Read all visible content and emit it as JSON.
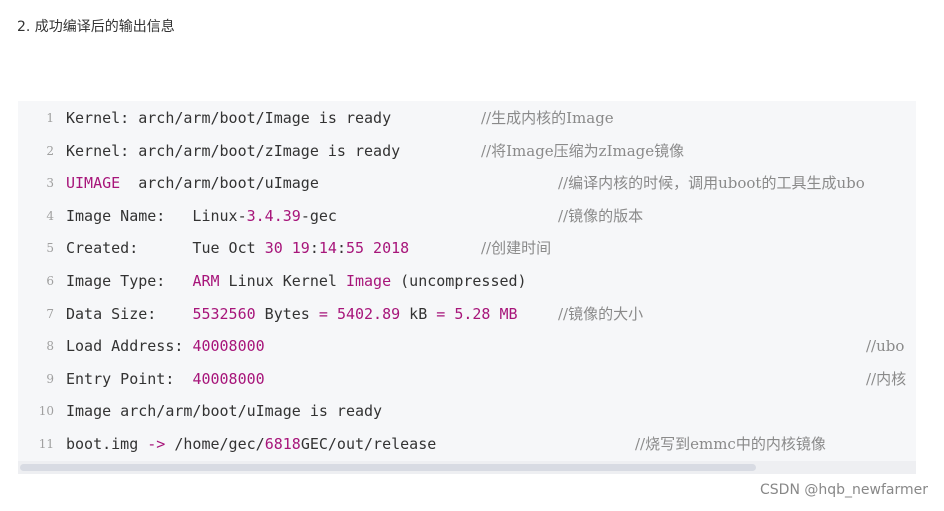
{
  "heading": "2. 成功编译后的输出信息",
  "code_lines": [
    {
      "number": "1",
      "segments": [
        {
          "t": "Kernel: arch/arm/boot/Image is ready"
        }
      ],
      "comment": "//生成内核的Image"
    },
    {
      "number": "2",
      "segments": [
        {
          "t": "Kernel: arch/arm/boot/zImage is ready"
        }
      ],
      "comment": "//将Image压缩为zImage镜像"
    },
    {
      "number": "3",
      "segments": [
        {
          "t": "UIMAGE",
          "c": "kw"
        },
        {
          "t": "  arch/arm/boot/uImage"
        }
      ],
      "comment": "//编译内核的时候，调用uboot的工具生成ubo"
    },
    {
      "number": "4",
      "segments": [
        {
          "t": "Image Name:   Linux-"
        },
        {
          "t": "3.4.39",
          "c": "num"
        },
        {
          "t": "-gec"
        }
      ],
      "comment": "//镜像的版本"
    },
    {
      "number": "5",
      "segments": [
        {
          "t": "Created:      Tue Oct "
        },
        {
          "t": "30 19",
          "c": "num"
        },
        {
          "t": ":"
        },
        {
          "t": "14",
          "c": "num"
        },
        {
          "t": ":"
        },
        {
          "t": "55 2018",
          "c": "num"
        }
      ],
      "comment": "//创建时间"
    },
    {
      "number": "6",
      "segments": [
        {
          "t": "Image Type:   "
        },
        {
          "t": "ARM",
          "c": "kw"
        },
        {
          "t": " Linux Kernel "
        },
        {
          "t": "Image",
          "c": "kw"
        },
        {
          "t": " (uncompressed)"
        }
      ],
      "comment": ""
    },
    {
      "number": "7",
      "segments": [
        {
          "t": "Data Size:    "
        },
        {
          "t": "5532560",
          "c": "num"
        },
        {
          "t": " Bytes "
        },
        {
          "t": "=",
          "c": "op"
        },
        {
          "t": " "
        },
        {
          "t": "5402.89",
          "c": "num"
        },
        {
          "t": " kB "
        },
        {
          "t": "=",
          "c": "op"
        },
        {
          "t": " "
        },
        {
          "t": "5.28 MB",
          "c": "num"
        }
      ],
      "comment": "//镜像的大小"
    },
    {
      "number": "8",
      "segments": [
        {
          "t": "Load Address: "
        },
        {
          "t": "40008000",
          "c": "num"
        }
      ],
      "comment": "//ubo"
    },
    {
      "number": "9",
      "segments": [
        {
          "t": "Entry Point:  "
        },
        {
          "t": "40008000",
          "c": "num"
        }
      ],
      "comment": "//内核"
    },
    {
      "number": "10",
      "segments": [
        {
          "t": "Image arch/arm/boot/uImage is ready"
        }
      ],
      "comment": ""
    },
    {
      "number": "11",
      "segments": [
        {
          "t": "boot.img "
        },
        {
          "t": "->",
          "c": "op"
        },
        {
          "t": " /home/gec/"
        },
        {
          "t": "6818",
          "c": "num"
        },
        {
          "t": "GEC/out/release"
        }
      ],
      "comment": "//烧写到emmc中的内核镜像"
    }
  ],
  "scroll_position": 0.0,
  "watermark": "CSDN @hqb_newfarmer"
}
